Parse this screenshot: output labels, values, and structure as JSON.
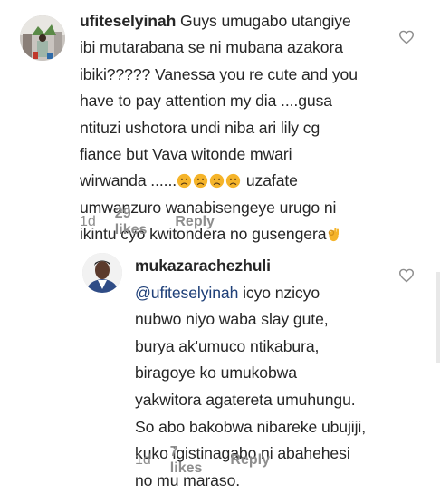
{
  "comments": [
    {
      "username": "ufiteselyinah",
      "lines": [
        "Guys umugabo utangiye",
        "ibi mutarabana se ni mubana azakora",
        "ibiki????? Vanessa you re cute and you",
        "have to pay attention my dia ....gusa",
        "ntituzi ushotora undi niba ari lily cg",
        "fiance  but Vava  witonde  mwari",
        "wirwanda ......",
        "uzafate",
        "umwanzuro wanabisengeye urugo ni",
        "ikintu cyo kwitondera no gusengera"
      ],
      "time": "1d",
      "likes": "29 likes",
      "reply": "Reply"
    },
    {
      "username": "mukazarachezhuli",
      "mention": "@ufiteselyinah",
      "lines": [
        "icyo nzicyo",
        "nubwo niyo waba slay gute,",
        "burya ak'umuco ntikabura,",
        "biragoye ko umukobwa",
        "yakwitora agatereta umuhungu.",
        "So abo bakobwa nibareke ubujiji,",
        "kuko igistinagabo ni abahehesi",
        "no mu maraso."
      ],
      "time": "1d",
      "likes": "7 likes",
      "reply": "Reply"
    }
  ],
  "icons": {
    "like": "heart-outline-icon",
    "sad": "sad-face-emoji",
    "ok_hand": "ok-hand-emoji"
  },
  "colors": {
    "text": "#262626",
    "meta": "#8e8e8e",
    "mention": "#1e3f78",
    "emoji": "#f5b42a"
  }
}
